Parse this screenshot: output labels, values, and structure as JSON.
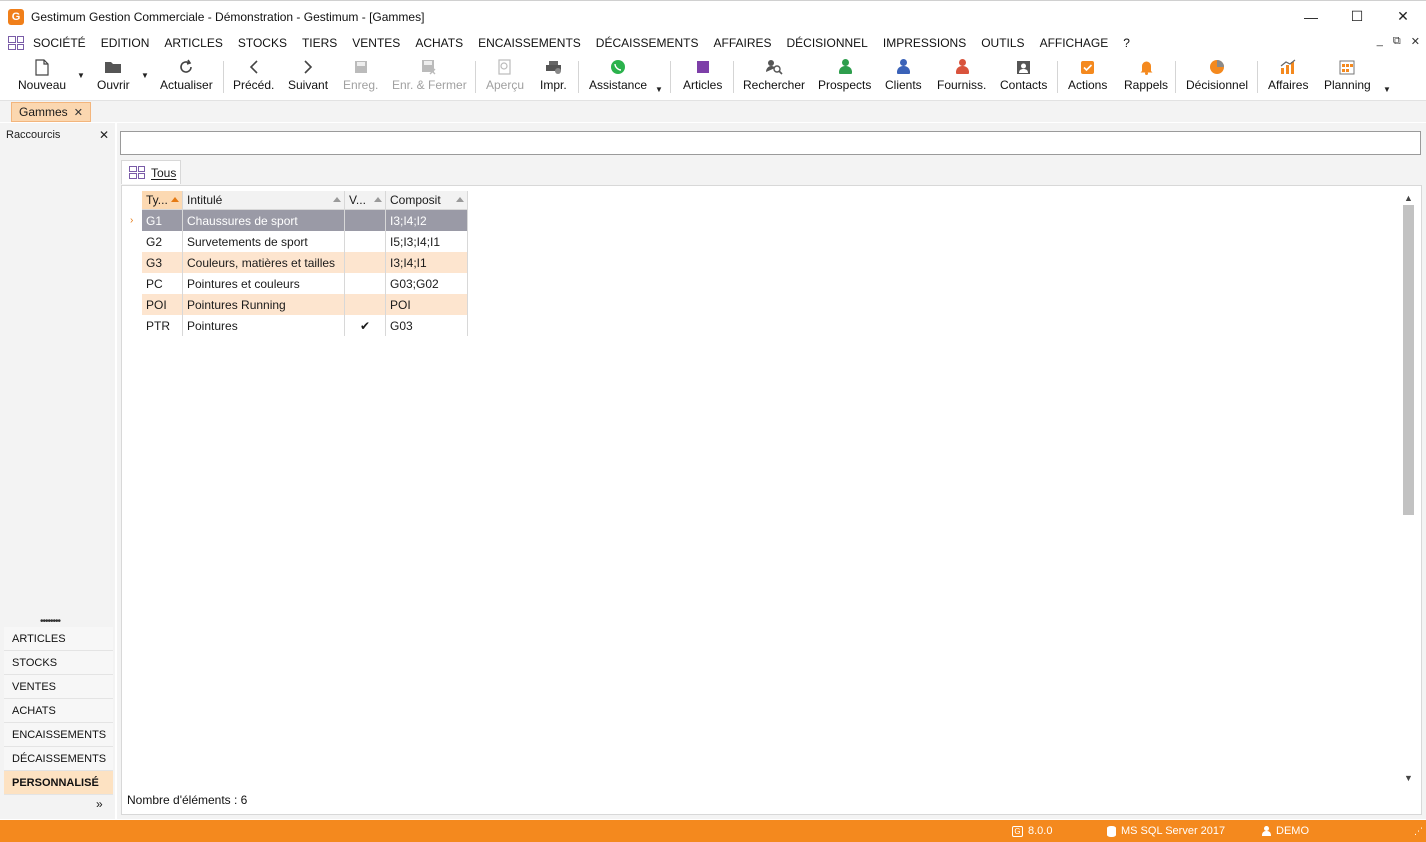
{
  "window": {
    "title": "Gestimum Gestion Commerciale - Démonstration - Gestimum - [Gammes]",
    "logo_letter": "G",
    "controls": {
      "minimize": "—",
      "maximize": "☐",
      "close": "✕"
    }
  },
  "menu": {
    "items": [
      "SOCIÉTÉ",
      "EDITION",
      "ARTICLES",
      "STOCKS",
      "TIERS",
      "VENTES",
      "ACHATS",
      "ENCAISSEMENTS",
      "DÉCAISSEMENTS",
      "AFFAIRES",
      "DÉCISIONNEL",
      "IMPRESSIONS",
      "OUTILS",
      "AFFICHAGE",
      "?"
    ],
    "mdi_controls": [
      "_",
      "⧉",
      "✕"
    ]
  },
  "toolbar": {
    "nouveau": "Nouveau",
    "ouvrir": "Ouvrir",
    "actualiser": "Actualiser",
    "preced": "Précéd.",
    "suivant": "Suivant",
    "enreg": "Enreg.",
    "enr_fermer": "Enr. & Fermer",
    "apercu": "Aperçu",
    "impr": "Impr.",
    "assistance": "Assistance",
    "articles": "Articles",
    "rechercher": "Rechercher",
    "prospects": "Prospects",
    "clients": "Clients",
    "fourniss": "Fourniss.",
    "contacts": "Contacts",
    "actions": "Actions",
    "rappels": "Rappels",
    "decisionnel": "Décisionnel",
    "affaires": "Affaires",
    "planning": "Planning"
  },
  "doc_tab": {
    "label": "Gammes",
    "close": "✕"
  },
  "left_panel": {
    "title": "Raccourcis",
    "close": "✕",
    "grip": "••••••••",
    "items": [
      "ARTICLES",
      "STOCKS",
      "VENTES",
      "ACHATS",
      "ENCAISSEMENTS",
      "DÉCAISSEMENTS",
      "PERSONNALISÉ"
    ],
    "more": "»"
  },
  "main": {
    "search_value": "",
    "view_tab": "Tous",
    "columns": [
      "Ty...",
      "Intitulé",
      "V...",
      "Composit"
    ],
    "rows": [
      {
        "type": "G1",
        "intitule": "Chaussures de sport",
        "v": "",
        "composit": "I3;I4;I2"
      },
      {
        "type": "G2",
        "intitule": "Survetements de sport",
        "v": "",
        "composit": "I5;I3;I4;I1"
      },
      {
        "type": "G3",
        "intitule": "Couleurs, matières et tailles",
        "v": "",
        "composit": "I3;I4;I1"
      },
      {
        "type": "PC",
        "intitule": "Pointures et couleurs",
        "v": "",
        "composit": "G03;G02"
      },
      {
        "type": "POI",
        "intitule": "Pointures Running",
        "v": "",
        "composit": "POI"
      },
      {
        "type": "PTR",
        "intitule": "Pointures",
        "v": "✔",
        "composit": "G03"
      }
    ],
    "row_indicator": "›",
    "count_text": "Nombre d'éléments : 6"
  },
  "statusbar": {
    "version": "8.0.0",
    "database": "MS SQL Server 2017",
    "user": "DEMO"
  },
  "colors": {
    "accent": "#f4891e",
    "selected_row": "#9a9aa6",
    "alt_row": "#fde5cf"
  }
}
